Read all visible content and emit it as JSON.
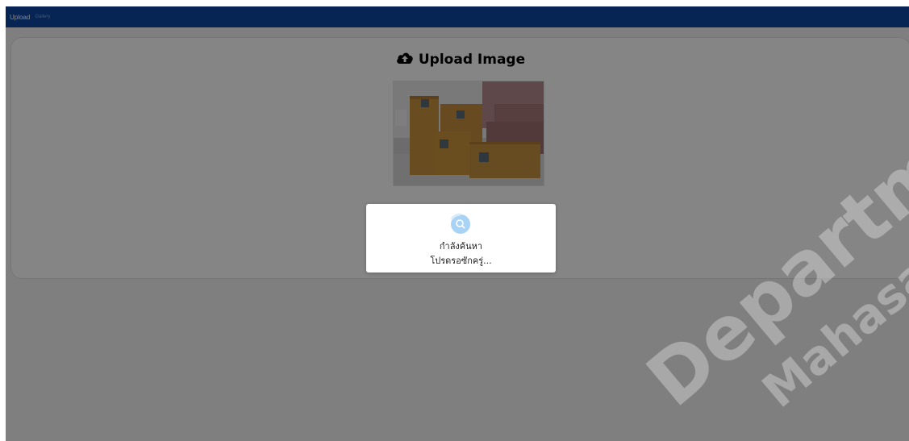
{
  "navbar": {
    "items": [
      {
        "label": "Upload",
        "active": true
      },
      {
        "label": "Gallery",
        "active": false
      }
    ],
    "background": "#0d47a1"
  },
  "upload": {
    "heading": "Upload Image",
    "heading_icon": "cloud-upload-icon",
    "preview_image": "preview-image"
  },
  "loading": {
    "icon": "search-spinner-icon",
    "title": "กำลังค้นหา",
    "subtitle": "โปรดรอซักครู่..."
  },
  "watermark": {
    "line1": "Department",
    "line2": "Mahasarakham University"
  }
}
